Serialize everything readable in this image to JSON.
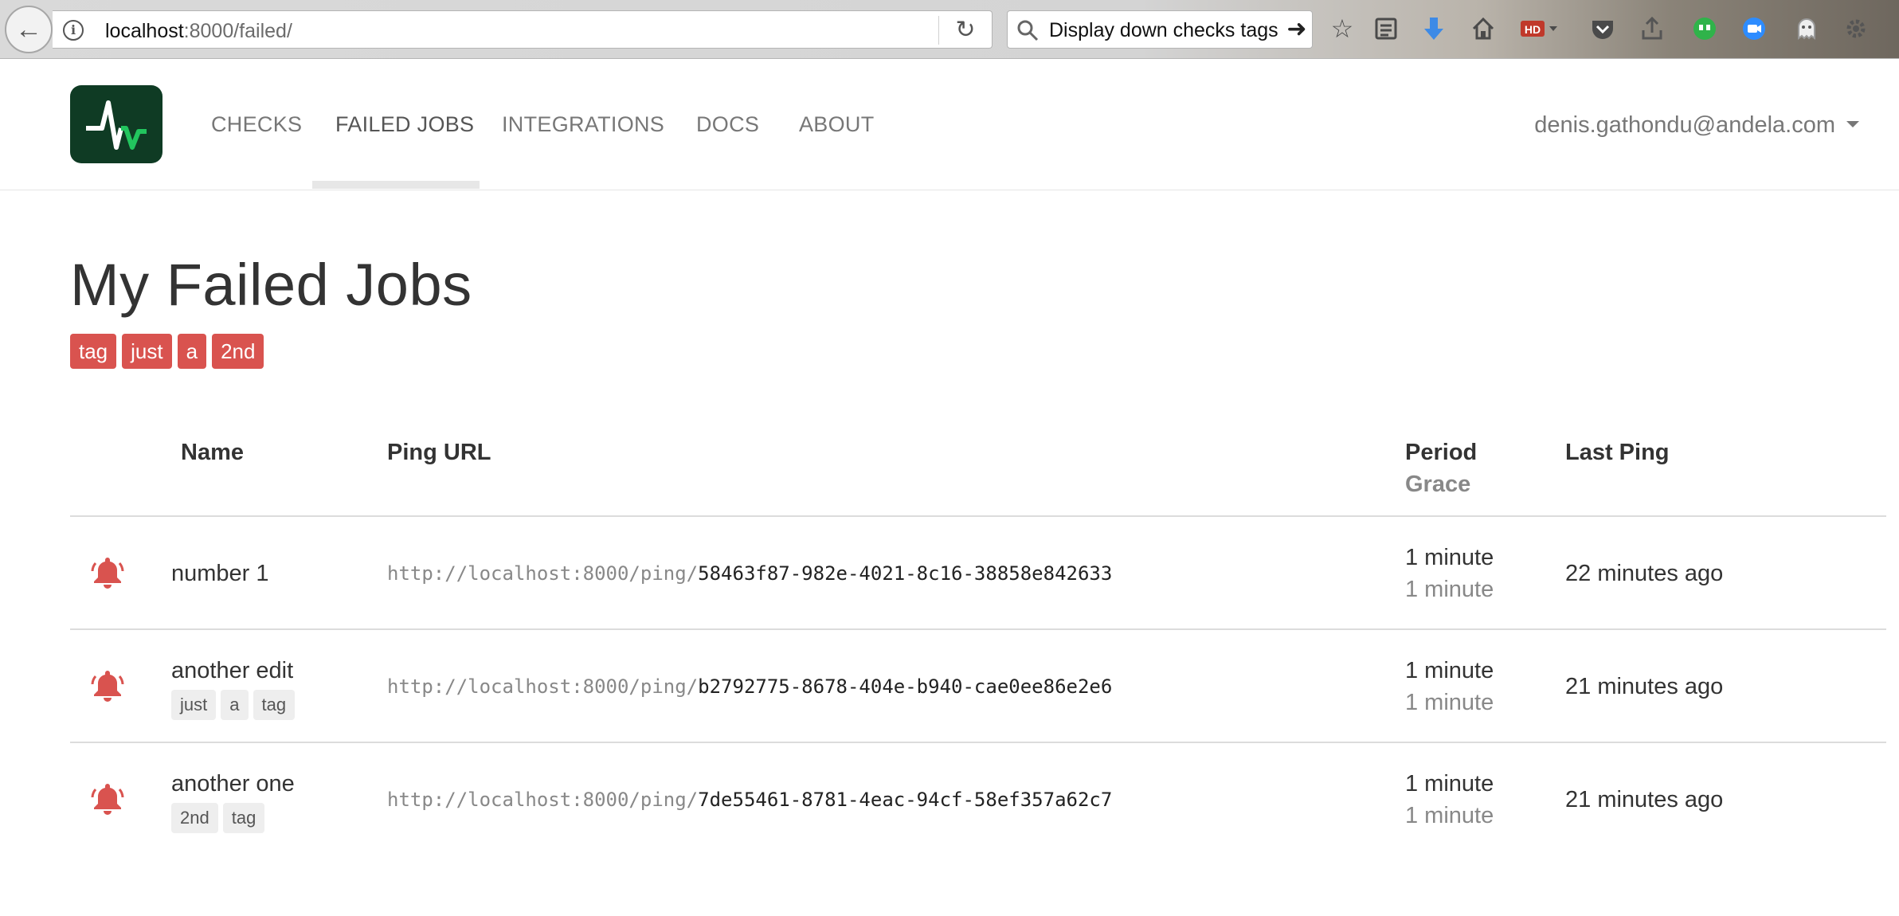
{
  "browser": {
    "url_host": "localhost",
    "url_rest": ":8000/failed/",
    "search_value": "Display down checks tags"
  },
  "nav": {
    "items": [
      {
        "label": "CHECKS"
      },
      {
        "label": "FAILED JOBS"
      },
      {
        "label": "INTEGRATIONS"
      },
      {
        "label": "DOCS"
      },
      {
        "label": "ABOUT"
      }
    ],
    "active": "FAILED JOBS",
    "user_email": "denis.gathondu@andela.com"
  },
  "page": {
    "title": "My Failed Jobs",
    "tag_filters": [
      "tag",
      "just",
      "a",
      "2nd"
    ]
  },
  "table": {
    "headers": {
      "name": "Name",
      "ping_url": "Ping URL",
      "period": "Period",
      "grace": "Grace",
      "last_ping": "Last Ping"
    },
    "rows": [
      {
        "name": "number 1",
        "tags": [],
        "ping_base": "http://localhost:8000/ping/",
        "ping_code": "58463f87-982e-4021-8c16-38858e842633",
        "period": "1 minute",
        "grace": "1 minute",
        "last_ping": "22 minutes ago"
      },
      {
        "name": "another edit",
        "tags": [
          "just",
          "a",
          "tag"
        ],
        "ping_base": "http://localhost:8000/ping/",
        "ping_code": "b2792775-8678-404e-b940-cae0ee86e2e6",
        "period": "1 minute",
        "grace": "1 minute",
        "last_ping": "21 minutes ago"
      },
      {
        "name": "another one",
        "tags": [
          "2nd",
          "tag"
        ],
        "ping_base": "http://localhost:8000/ping/",
        "ping_code": "7de55461-8781-4eac-94cf-58ef357a62c7",
        "period": "1 minute",
        "grace": "1 minute",
        "last_ping": "21 minutes ago"
      }
    ]
  },
  "colors": {
    "tag_filter": "#d9534f",
    "bell": "#d9534f",
    "logo_bg": "#0f3b24",
    "logo_accent": "#22c55e"
  },
  "icons": {
    "row_status": "bell-icon",
    "toolbar": [
      "star-icon",
      "reading-list-icon",
      "download-icon",
      "home-icon",
      "hd-icon",
      "pocket-icon",
      "share-icon",
      "hangouts-icon",
      "zoom-icon",
      "ghost-icon",
      "settings-icon"
    ]
  }
}
